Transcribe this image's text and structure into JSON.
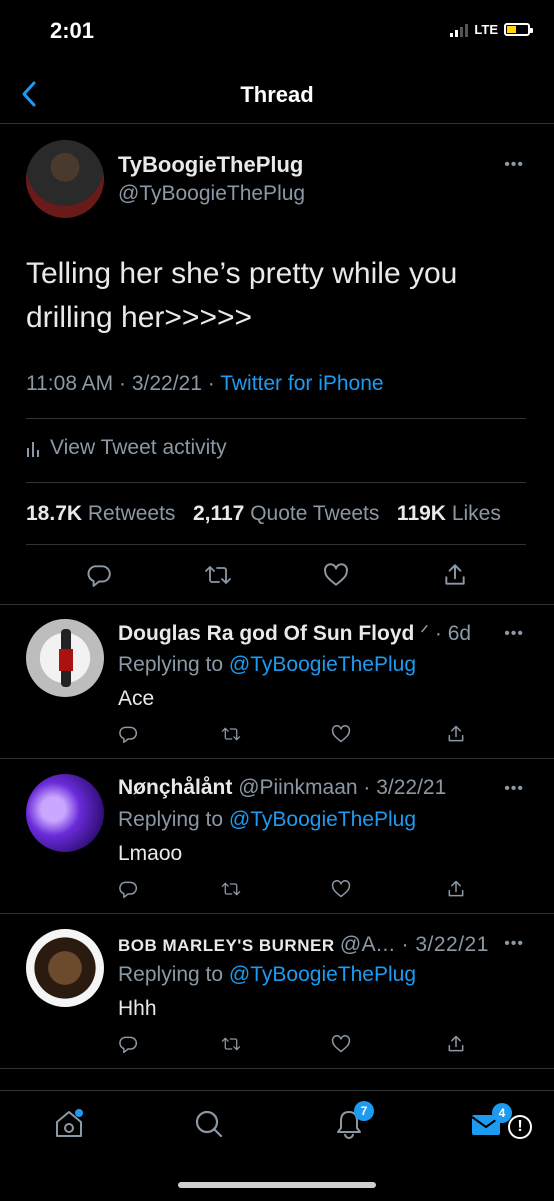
{
  "status": {
    "time": "2:01",
    "network": "LTE"
  },
  "header": {
    "title": "Thread"
  },
  "tweet": {
    "name": "TyBoogieThePlug",
    "handle": "@TyBoogieThePlug",
    "text": "Telling her she’s pretty while you drilling her>>>>>",
    "time": "11:08 AM · 3/22/21 · ",
    "source": "Twitter for iPhone",
    "activity": "View Tweet activity",
    "stats": [
      {
        "value": "18.7K",
        "label": "Retweets"
      },
      {
        "value": "2,117",
        "label": "Quote Tweets"
      },
      {
        "value": "119K",
        "label": "Likes"
      }
    ]
  },
  "replies": [
    {
      "name": "Douglas Ra god Of Sun Floyd",
      "handle": "",
      "suffix": "ᐟ · 6d",
      "replying_prefix": "Replying to",
      "replying_to": "@TyBoogieThePlug",
      "text": "Ace"
    },
    {
      "name": "Nønçhålånt",
      "handle": "@Piinkmaan",
      "suffix": " · 3/22/21",
      "replying_prefix": "Replying to",
      "replying_to": "@TyBoogieThePlug",
      "text": "Lmaoo"
    },
    {
      "name": "BOB MARLEY'S BURNER",
      "handle": "@A...",
      "suffix": " · 3/22/21",
      "replying_prefix": "Replying to",
      "replying_to": "@TyBoogieThePlug",
      "text": "Hhh"
    }
  ],
  "tabbar": {
    "notifications_badge": "7",
    "messages_badge": "4",
    "alert_glyph": "!"
  },
  "colors": {
    "accent": "#1d9bf0",
    "background": "#000000",
    "divider": "#2f3336"
  },
  "icons": [
    "back-chevron-icon",
    "more-icon",
    "bar-chart-icon",
    "reply-icon",
    "retweet-icon",
    "like-icon",
    "share-icon",
    "home-icon",
    "search-icon",
    "bell-icon",
    "mail-icon"
  ]
}
